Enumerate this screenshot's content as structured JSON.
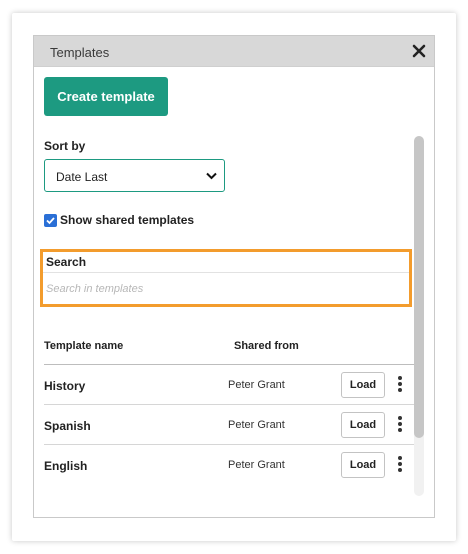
{
  "dialog": {
    "title": "Templates",
    "close_icon": "close-icon"
  },
  "create_button": "Create template",
  "sort": {
    "label": "Sort by",
    "selected": "Date Last"
  },
  "shared": {
    "checked": true,
    "label": "Show shared templates"
  },
  "search": {
    "label": "Search",
    "placeholder": "Search in templates",
    "highlight_color": "#f39c2d"
  },
  "table": {
    "headers": [
      "Template name",
      "Shared from"
    ],
    "rows": [
      {
        "name": "History",
        "shared_from": "Peter Grant",
        "action": "Load"
      },
      {
        "name": "Spanish",
        "shared_from": "Peter Grant",
        "action": "Load"
      },
      {
        "name": "English",
        "shared_from": "Peter Grant",
        "action": "Load"
      }
    ]
  },
  "colors": {
    "accent": "#1d9a81",
    "checkbox": "#2a6fd6"
  }
}
